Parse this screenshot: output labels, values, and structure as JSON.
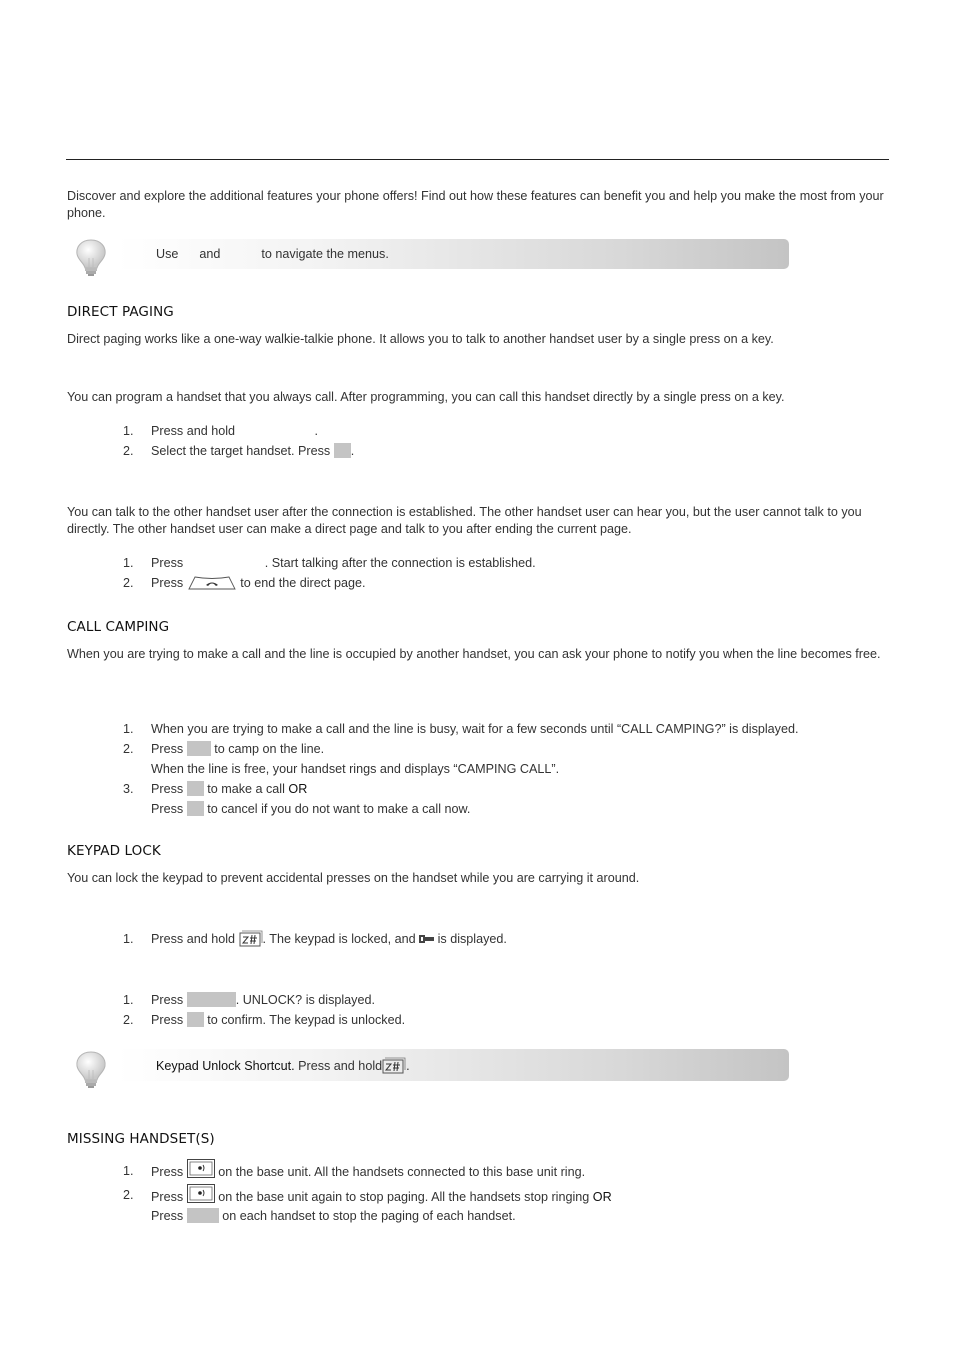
{
  "intro": "Discover and explore the additional features your phone offers! Find out how these features can benefit you and help you make the most from your phone.",
  "tip1": {
    "use": "Use",
    "and": "and",
    "rest": "to navigate the menus."
  },
  "direct_paging": {
    "heading": "DIRECT PAGING",
    "desc": "Direct paging works like a one-way walkie-talkie phone. It allows you to talk to another handset user by a single press on a key.",
    "program_desc": "You can program a handset that you always call. After programming, you can call this handset directly by a single press on a key.",
    "program_steps": [
      {
        "num": "1.",
        "text": "Press and hold",
        "after": "."
      },
      {
        "num": "2.",
        "text": "Select the target handset. Press",
        "after": "."
      }
    ],
    "talk_desc": "You can talk to the other handset user after the connection is established. The other handset user can hear you, but the user cannot talk to you directly. The other handset user can make a direct page and talk to you after ending the current page.",
    "talk_steps": [
      {
        "num": "1.",
        "text": "Press",
        "after": ". Start talking after the connection is established."
      },
      {
        "num": "2.",
        "text": "Press",
        "after": "to end the direct page."
      }
    ]
  },
  "call_camping": {
    "heading": "CALL CAMPING",
    "desc": "When you are trying to make a call and the line is occupied by another handset, you can ask your phone to notify you when the line becomes free.",
    "steps": [
      {
        "num": "1.",
        "text": "When you are trying to make a call and the line is busy, wait for a few seconds until “CALL CAMPING?” is displayed."
      },
      {
        "num": "2.",
        "text": "Press",
        "after": "to camp on the line."
      },
      {
        "num": "",
        "text": "When the line is free, your handset rings and displays “CAMPING CALL”."
      },
      {
        "num": "3.",
        "text": "Press",
        "after": "to make a call",
        "or": "OR"
      },
      {
        "num": "",
        "text": "Press",
        "after": "to cancel if you do not want to make a call now."
      }
    ]
  },
  "keypad_lock": {
    "heading": "KEYPAD LOCK",
    "desc": "You can lock the keypad to prevent accidental presses on the handset while you are carrying it around.",
    "lock_steps": [
      {
        "num": "1.",
        "text": "Press and hold",
        "mid": ". The keypad is locked, and",
        "after": "is displayed."
      }
    ],
    "unlock_steps": [
      {
        "num": "1.",
        "text": "Press",
        "after": ". UNLOCK? is displayed."
      },
      {
        "num": "2.",
        "text": "Press",
        "after": "to confirm. The keypad is unlocked."
      }
    ]
  },
  "tip2": {
    "bold": "Keypad Unlock Shortcut.",
    "rest": "Press and hold",
    "end": "."
  },
  "missing_handsets": {
    "heading": "MISSING HANDSET(S)",
    "steps": [
      {
        "num": "1.",
        "text": "Press",
        "after": "on the base unit. All the handsets connected to this base unit ring."
      },
      {
        "num": "2.",
        "text": "Press",
        "after": "on the base unit again to stop paging. All the handsets stop ringing",
        "or": "OR"
      },
      {
        "num": "",
        "text": "Press",
        "after": "on each handset to stop the paging of each handset."
      }
    ]
  },
  "icons": {
    "tip": "lightbulb-icon",
    "end_call": "end-call-key-icon",
    "star_hash": "star-hash-key-icon",
    "lock": "lock-icon",
    "page": "page-key-icon"
  },
  "colors": {
    "key_placeholder": "#c4c4c4",
    "tip_gradient_end": "#c4c4c4",
    "rule": "#222222"
  }
}
